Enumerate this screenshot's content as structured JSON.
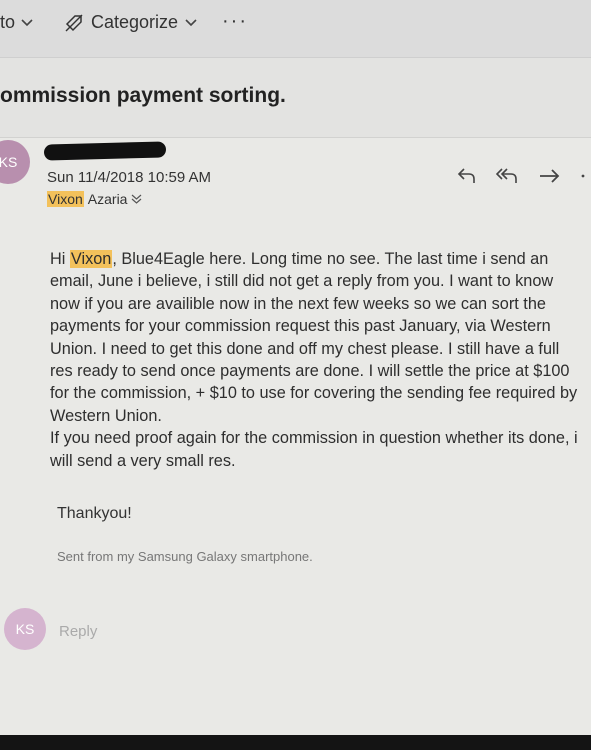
{
  "toolbar": {
    "to_label": "to",
    "categorize_label": "Categorize",
    "more_label": "···"
  },
  "message": {
    "subject": "ommission payment sorting.",
    "avatar_initials": "KS",
    "date": "Sun 11/4/2018 10:59 AM",
    "recipient_first": "Vixon",
    "recipient_last": "Azaria",
    "greeting_hi": "Hi",
    "greeting_name": "Vixon",
    "body_rest": ", Blue4Eagle here. Long time no see. The last time i send an email, June i believe, i still did not get a reply from you. I want to know now if you are availible now in the next few weeks so we can sort the payments for your commission request this past January, via Western Union. I need to get this done and off my chest please. I still have a full res ready to send once payments are done. I will settle the price at $100 for the commission, + $10 to use for covering the sending fee required by Western Union.",
    "body_second": "If you need proof again for the commission in question whether its done, i will send a very small res.",
    "closing": "Thankyou!",
    "signature": "Sent from my Samsung Galaxy smartphone."
  },
  "reply_area": {
    "avatar_initials": "KS",
    "reply_label": "Reply"
  }
}
